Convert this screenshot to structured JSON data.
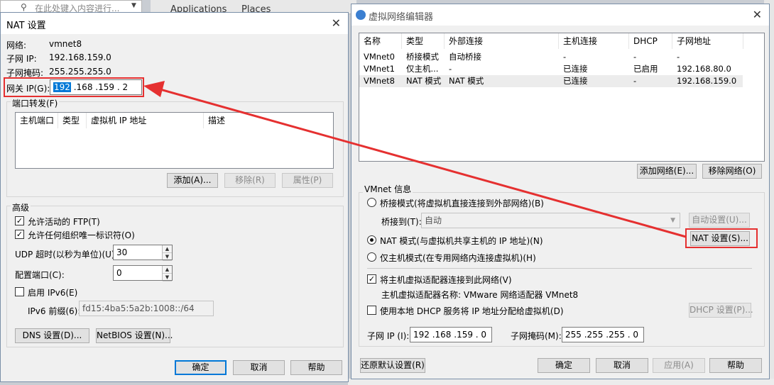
{
  "background": {
    "search_placeholder": "在此处键入内容进行...",
    "apps_label": "Applications",
    "places_label": "Places"
  },
  "nat_dialog": {
    "title": "NAT 设置",
    "network_label": "网络:",
    "network_value": "vmnet8",
    "subnet_ip_label": "子网 IP:",
    "subnet_ip_value": "192.168.159.0",
    "subnet_mask_label": "子网掩码:",
    "subnet_mask_value": "255.255.255.0",
    "gateway_label": "网关 IP(G):",
    "gateway_octets": [
      "192",
      ".168",
      ".159",
      ".  2"
    ],
    "port_forward_title": "端口转发(F)",
    "port_columns": [
      "主机端口",
      "类型",
      "虚拟机 IP 地址",
      "描述"
    ],
    "add_button": "添加(A)...",
    "remove_button": "移除(R)",
    "properties_button": "属性(P)",
    "advanced_title": "高级",
    "allow_ftp": "允许活动的 FTP(T)",
    "allow_uid": "允许任何组织唯一标识符(O)",
    "udp_timeout_label": "UDP 超时(以秒为单位)(U):",
    "udp_timeout_value": "30",
    "config_port_label": "配置端口(C):",
    "config_port_value": "0",
    "enable_ipv6": "启用 IPv6(E)",
    "ipv6_prefix_label": "IPv6 前缀(6):",
    "ipv6_prefix_value": "fd15:4ba5:5a2b:1008::/64",
    "dns_button": "DNS 设置(D)...",
    "netbios_button": "NetBIOS 设置(N)...",
    "ok_button": "确定",
    "cancel_button": "取消",
    "help_button": "帮助"
  },
  "vne": {
    "title": "虚拟网络编辑器",
    "columns": [
      "名称",
      "类型",
      "外部连接",
      "主机连接",
      "DHCP",
      "子网地址"
    ],
    "rows": [
      {
        "name": "VMnet0",
        "type": "桥接模式",
        "ext": "自动桥接",
        "host": "-",
        "dhcp": "-",
        "subnet": "-"
      },
      {
        "name": "VMnet1",
        "type": "仅主机...",
        "ext": "-",
        "host": "已连接",
        "dhcp": "已启用",
        "subnet": "192.168.80.0"
      },
      {
        "name": "VMnet8",
        "type": "NAT 模式",
        "ext": "NAT 模式",
        "host": "已连接",
        "dhcp": "-",
        "subnet": "192.168.159.0"
      }
    ],
    "add_network": "添加网络(E)...",
    "remove_network": "移除网络(O)",
    "info_title": "VMnet 信息",
    "bridged_radio": "桥接模式(将虚拟机直接连接到外部网络)(B)",
    "bridged_to_label": "桥接到(T):",
    "bridged_to_value": "自动",
    "auto_settings": "自动设置(U)...",
    "nat_radio": "NAT 模式(与虚拟机共享主机的 IP 地址)(N)",
    "nat_settings": "NAT 设置(S)...",
    "hostonly_radio": "仅主机模式(在专用网络内连接虚拟机)(H)",
    "connect_adapter": "将主机虚拟适配器连接到此网络(V)",
    "adapter_name": "主机虚拟适配器名称: VMware 网络适配器 VMnet8",
    "use_dhcp": "使用本地 DHCP 服务将 IP 地址分配给虚拟机(D)",
    "dhcp_settings": "DHCP 设置(P)...",
    "subnet_ip_label": "子网 IP (I):",
    "subnet_ip_value": "192 .168 .159 . 0",
    "subnet_mask_label": "子网掩码(M):",
    "subnet_mask_value": "255 .255 .255 . 0",
    "restore_defaults": "还原默认设置(R)",
    "ok_button": "确定",
    "cancel_button": "取消",
    "apply_button": "应用(A)",
    "help_button": "帮助"
  },
  "colors": {
    "highlight": "#e53030",
    "selection": "#0078d7"
  }
}
